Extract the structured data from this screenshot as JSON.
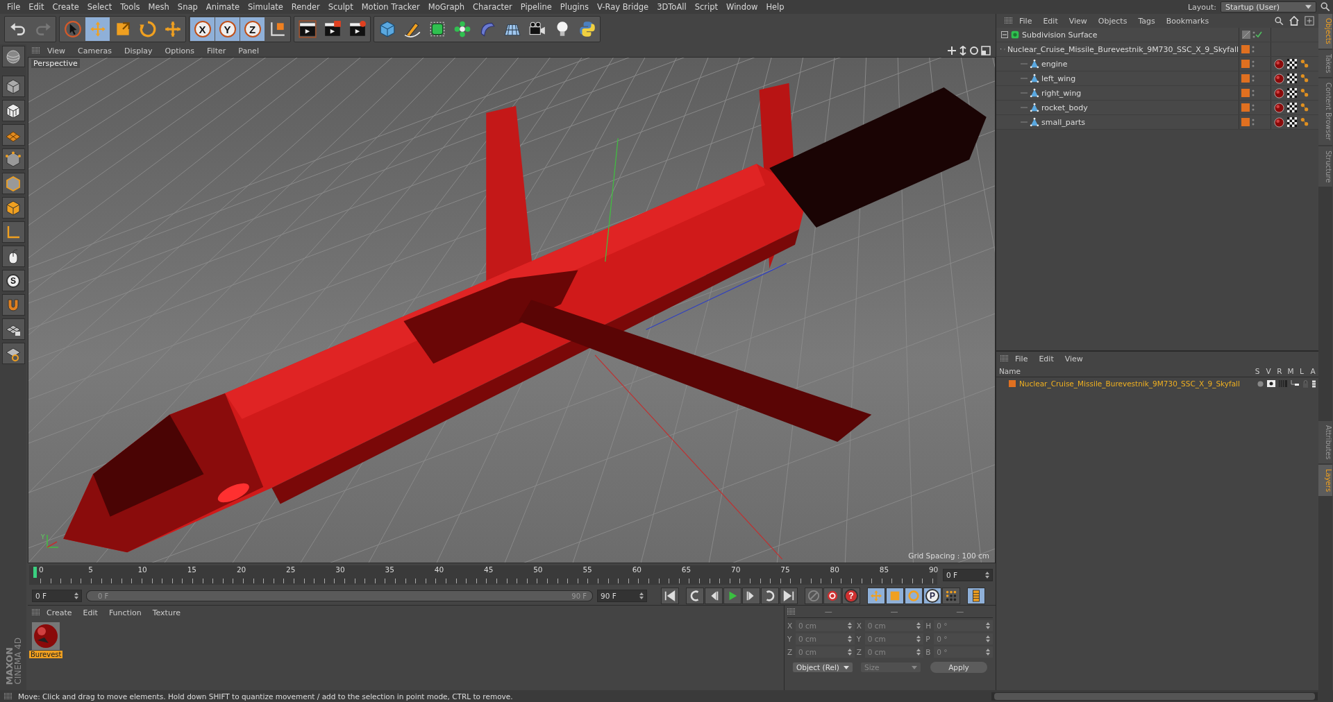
{
  "menu": [
    "File",
    "Edit",
    "Create",
    "Select",
    "Tools",
    "Mesh",
    "Snap",
    "Animate",
    "Simulate",
    "Render",
    "Sculpt",
    "Motion Tracker",
    "MoGraph",
    "Character",
    "Pipeline",
    "Plugins",
    "V-Ray Bridge",
    "3DToAll",
    "Script",
    "Window",
    "Help"
  ],
  "layout": {
    "label": "Layout:",
    "value": "Startup (User)"
  },
  "toolbar": [
    {
      "kind": "undo",
      "selected": false
    },
    {
      "kind": "redo",
      "selected": false
    },
    {
      "kind": "select",
      "selected": false
    },
    {
      "kind": "move",
      "selected": true
    },
    {
      "kind": "scale",
      "selected": false
    },
    {
      "kind": "rotate",
      "selected": false
    },
    {
      "kind": "add",
      "selected": false
    },
    {
      "kind": "x",
      "label": "X",
      "selected": true
    },
    {
      "kind": "y",
      "label": "Y",
      "selected": true
    },
    {
      "kind": "z",
      "label": "Z",
      "selected": true
    },
    {
      "kind": "coords",
      "selected": false
    },
    {
      "kind": "render-view",
      "selected": false
    },
    {
      "kind": "render",
      "selected": false
    },
    {
      "kind": "render-settings",
      "selected": false
    },
    {
      "kind": "cube",
      "selected": false
    },
    {
      "kind": "pen",
      "selected": false
    },
    {
      "kind": "subdivide",
      "selected": false
    },
    {
      "kind": "cloner",
      "selected": false
    },
    {
      "kind": "deformer",
      "selected": false
    },
    {
      "kind": "floor",
      "selected": false
    },
    {
      "kind": "camera",
      "selected": false
    },
    {
      "kind": "light",
      "selected": false
    },
    {
      "kind": "python",
      "selected": false
    }
  ],
  "viewport": {
    "menu": [
      "View",
      "Cameras",
      "Display",
      "Options",
      "Filter",
      "Panel"
    ],
    "camera": "Perspective",
    "grid_spacing": "Grid Spacing : 100 cm",
    "axis_label": "Y"
  },
  "object_manager": {
    "menu": [
      "File",
      "Edit",
      "View",
      "Objects",
      "Tags",
      "Bookmarks"
    ],
    "tree": [
      {
        "name": "Subdivision Surface",
        "kind": "subdivision",
        "expanded": true,
        "children": [
          {
            "name": "Nuclear_Cruise_Missile_Burevestnik_9M730_SSC_X_9_Skyfall",
            "kind": "null",
            "expanded": true,
            "children": [
              {
                "name": "engine",
                "kind": "polygon"
              },
              {
                "name": "left_wing",
                "kind": "polygon"
              },
              {
                "name": "right_wing",
                "kind": "polygon"
              },
              {
                "name": "rocket_body",
                "kind": "polygon"
              },
              {
                "name": "small_parts",
                "kind": "polygon"
              }
            ]
          }
        ]
      }
    ]
  },
  "side_tabs_top": [
    {
      "label": "Objects",
      "selected": true
    },
    {
      "label": "Takes",
      "selected": false
    },
    {
      "label": "Content Browser",
      "selected": false
    },
    {
      "label": "Structure",
      "selected": false
    }
  ],
  "side_tabs_bottom": [
    {
      "label": "Attributes",
      "selected": false
    },
    {
      "label": "Layers",
      "selected": true
    }
  ],
  "layers": {
    "menu": [
      "File",
      "Edit",
      "View"
    ],
    "columns": [
      "Name",
      "S",
      "V",
      "R",
      "M",
      "L",
      "A"
    ],
    "rows": [
      {
        "name": "Nuclear_Cruise_Missile_Burevestnik_9M730_SSC_X_9_Skyfall",
        "color": "#e07020"
      }
    ]
  },
  "timeline": {
    "ticks": [
      "0",
      "5",
      "10",
      "15",
      "20",
      "25",
      "30",
      "35",
      "40",
      "45",
      "50",
      "55",
      "60",
      "65",
      "70",
      "75",
      "80",
      "85",
      "90"
    ],
    "current": "0 F"
  },
  "transport": {
    "start": "0 F",
    "range_start": "0 F",
    "range_end": "90 F",
    "level": 1,
    "end": "90 F"
  },
  "tool_labels": {
    "snap": "S",
    "autokey": "?",
    "parameter": "P"
  },
  "materials": {
    "menu": [
      "Create",
      "Edit",
      "Function",
      "Texture"
    ],
    "items": [
      {
        "name": "Burevest",
        "selected": true
      }
    ]
  },
  "coordinates": {
    "headers": [
      "—",
      "—",
      "—"
    ],
    "rows": [
      [
        {
          "label": "X",
          "value": "0 cm"
        },
        {
          "label": "X",
          "value": "0 cm"
        },
        {
          "label": "H",
          "value": "0 °"
        }
      ],
      [
        {
          "label": "Y",
          "value": "0 cm"
        },
        {
          "label": "Y",
          "value": "0 cm"
        },
        {
          "label": "P",
          "value": "0 °"
        }
      ],
      [
        {
          "label": "Z",
          "value": "0 cm"
        },
        {
          "label": "Z",
          "value": "0 cm"
        },
        {
          "label": "B",
          "value": "0 °"
        }
      ]
    ],
    "disabled": true,
    "mode": "Object (Rel)",
    "size": "Size",
    "apply": "Apply"
  },
  "brand": [
    "MAXON",
    "CINEMA 4D"
  ],
  "status": "Move: Click and drag to move elements. Hold down SHIFT to quantize movement / add to the selection in point mode, CTRL to remove."
}
